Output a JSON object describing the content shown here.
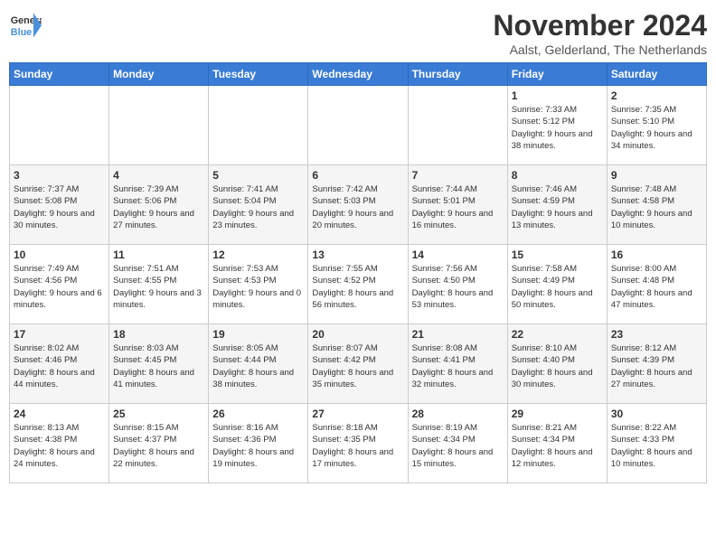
{
  "logo": {
    "line1": "General",
    "line2": "Blue"
  },
  "title": "November 2024",
  "subtitle": "Aalst, Gelderland, The Netherlands",
  "days_of_week": [
    "Sunday",
    "Monday",
    "Tuesday",
    "Wednesday",
    "Thursday",
    "Friday",
    "Saturday"
  ],
  "weeks": [
    [
      {
        "day": "",
        "info": ""
      },
      {
        "day": "",
        "info": ""
      },
      {
        "day": "",
        "info": ""
      },
      {
        "day": "",
        "info": ""
      },
      {
        "day": "",
        "info": ""
      },
      {
        "day": "1",
        "info": "Sunrise: 7:33 AM\nSunset: 5:12 PM\nDaylight: 9 hours and 38 minutes."
      },
      {
        "day": "2",
        "info": "Sunrise: 7:35 AM\nSunset: 5:10 PM\nDaylight: 9 hours and 34 minutes."
      }
    ],
    [
      {
        "day": "3",
        "info": "Sunrise: 7:37 AM\nSunset: 5:08 PM\nDaylight: 9 hours and 30 minutes."
      },
      {
        "day": "4",
        "info": "Sunrise: 7:39 AM\nSunset: 5:06 PM\nDaylight: 9 hours and 27 minutes."
      },
      {
        "day": "5",
        "info": "Sunrise: 7:41 AM\nSunset: 5:04 PM\nDaylight: 9 hours and 23 minutes."
      },
      {
        "day": "6",
        "info": "Sunrise: 7:42 AM\nSunset: 5:03 PM\nDaylight: 9 hours and 20 minutes."
      },
      {
        "day": "7",
        "info": "Sunrise: 7:44 AM\nSunset: 5:01 PM\nDaylight: 9 hours and 16 minutes."
      },
      {
        "day": "8",
        "info": "Sunrise: 7:46 AM\nSunset: 4:59 PM\nDaylight: 9 hours and 13 minutes."
      },
      {
        "day": "9",
        "info": "Sunrise: 7:48 AM\nSunset: 4:58 PM\nDaylight: 9 hours and 10 minutes."
      }
    ],
    [
      {
        "day": "10",
        "info": "Sunrise: 7:49 AM\nSunset: 4:56 PM\nDaylight: 9 hours and 6 minutes."
      },
      {
        "day": "11",
        "info": "Sunrise: 7:51 AM\nSunset: 4:55 PM\nDaylight: 9 hours and 3 minutes."
      },
      {
        "day": "12",
        "info": "Sunrise: 7:53 AM\nSunset: 4:53 PM\nDaylight: 9 hours and 0 minutes."
      },
      {
        "day": "13",
        "info": "Sunrise: 7:55 AM\nSunset: 4:52 PM\nDaylight: 8 hours and 56 minutes."
      },
      {
        "day": "14",
        "info": "Sunrise: 7:56 AM\nSunset: 4:50 PM\nDaylight: 8 hours and 53 minutes."
      },
      {
        "day": "15",
        "info": "Sunrise: 7:58 AM\nSunset: 4:49 PM\nDaylight: 8 hours and 50 minutes."
      },
      {
        "day": "16",
        "info": "Sunrise: 8:00 AM\nSunset: 4:48 PM\nDaylight: 8 hours and 47 minutes."
      }
    ],
    [
      {
        "day": "17",
        "info": "Sunrise: 8:02 AM\nSunset: 4:46 PM\nDaylight: 8 hours and 44 minutes."
      },
      {
        "day": "18",
        "info": "Sunrise: 8:03 AM\nSunset: 4:45 PM\nDaylight: 8 hours and 41 minutes."
      },
      {
        "day": "19",
        "info": "Sunrise: 8:05 AM\nSunset: 4:44 PM\nDaylight: 8 hours and 38 minutes."
      },
      {
        "day": "20",
        "info": "Sunrise: 8:07 AM\nSunset: 4:42 PM\nDaylight: 8 hours and 35 minutes."
      },
      {
        "day": "21",
        "info": "Sunrise: 8:08 AM\nSunset: 4:41 PM\nDaylight: 8 hours and 32 minutes."
      },
      {
        "day": "22",
        "info": "Sunrise: 8:10 AM\nSunset: 4:40 PM\nDaylight: 8 hours and 30 minutes."
      },
      {
        "day": "23",
        "info": "Sunrise: 8:12 AM\nSunset: 4:39 PM\nDaylight: 8 hours and 27 minutes."
      }
    ],
    [
      {
        "day": "24",
        "info": "Sunrise: 8:13 AM\nSunset: 4:38 PM\nDaylight: 8 hours and 24 minutes."
      },
      {
        "day": "25",
        "info": "Sunrise: 8:15 AM\nSunset: 4:37 PM\nDaylight: 8 hours and 22 minutes."
      },
      {
        "day": "26",
        "info": "Sunrise: 8:16 AM\nSunset: 4:36 PM\nDaylight: 8 hours and 19 minutes."
      },
      {
        "day": "27",
        "info": "Sunrise: 8:18 AM\nSunset: 4:35 PM\nDaylight: 8 hours and 17 minutes."
      },
      {
        "day": "28",
        "info": "Sunrise: 8:19 AM\nSunset: 4:34 PM\nDaylight: 8 hours and 15 minutes."
      },
      {
        "day": "29",
        "info": "Sunrise: 8:21 AM\nSunset: 4:34 PM\nDaylight: 8 hours and 12 minutes."
      },
      {
        "day": "30",
        "info": "Sunrise: 8:22 AM\nSunset: 4:33 PM\nDaylight: 8 hours and 10 minutes."
      }
    ]
  ]
}
